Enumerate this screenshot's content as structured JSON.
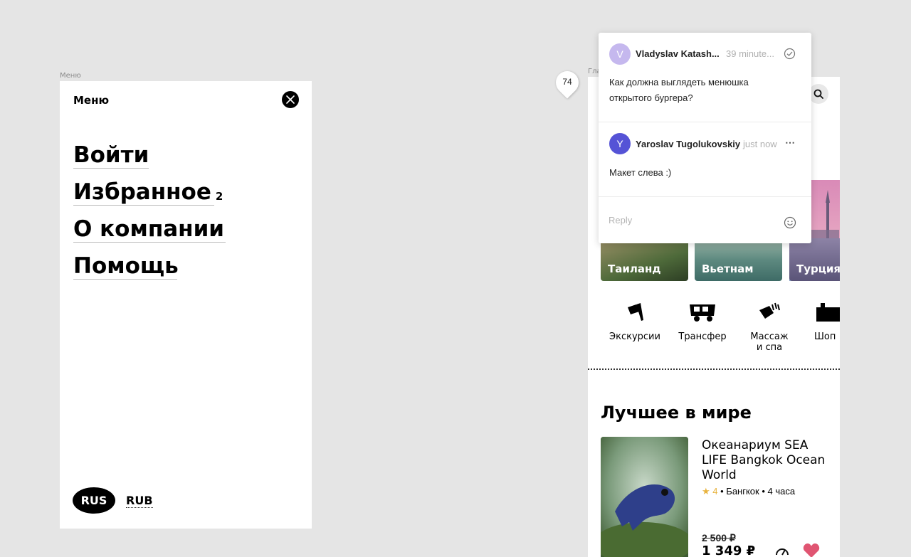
{
  "labels": {
    "menu_frame": "Меню",
    "main_frame": "Гла"
  },
  "menu": {
    "title": "Меню",
    "items": [
      {
        "label": "Войти"
      },
      {
        "label": "Избранное",
        "badge": "2"
      },
      {
        "label": "О компании"
      },
      {
        "label": "Помощь"
      }
    ],
    "language": "RUS",
    "currency": "RUB"
  },
  "pin": {
    "count": "74"
  },
  "comments": [
    {
      "avatar": "V",
      "avatar_color": "#c5b8ee",
      "author": "Vladyslav Katash...",
      "time": "39 minute...",
      "text": "Как должна выглядеть менюшка открытого бургера?"
    },
    {
      "avatar": "Y",
      "avatar_color": "#5553d6",
      "author": "Yaroslav Tugolukovskiy",
      "time": "just now",
      "text": "Макет слева :)"
    }
  ],
  "reply": {
    "placeholder": "Reply"
  },
  "main": {
    "destinations": [
      "Таиланд",
      "Вьетнам",
      "Турция"
    ],
    "services": [
      {
        "label": "Экскурсии",
        "icon": "flag-icon"
      },
      {
        "label": "Трансфер",
        "icon": "bus-icon"
      },
      {
        "label": "Массаж\nи спа",
        "icon": "massage-icon"
      },
      {
        "label": "Шоп",
        "icon": "shopping-icon"
      }
    ],
    "section_title": "Лучшее в мире",
    "product": {
      "title": "Океанариум SEA LIFE Bangkok Ocean World",
      "rating": "★ 4",
      "meta": "• Бангкок • 4 часа",
      "old_price": "2 500 ₽",
      "price": "1 349 ₽"
    }
  },
  "colors": {
    "accent_heart": "#e05572",
    "star": "#e8b33f"
  }
}
